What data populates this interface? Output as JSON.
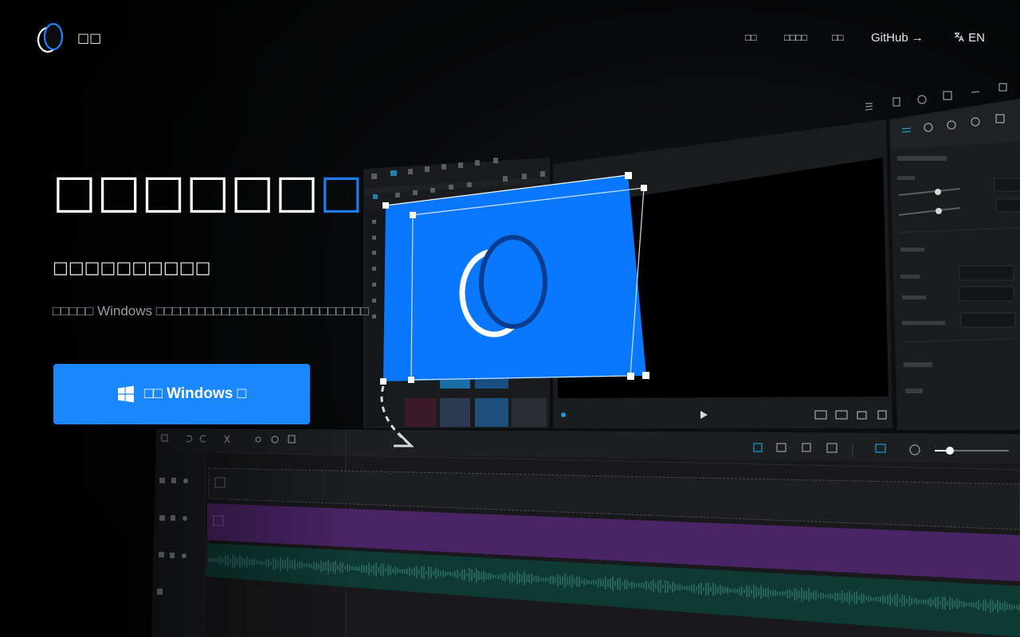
{
  "header": {
    "brand": "□□",
    "nav": [
      {
        "label": "□□"
      },
      {
        "label": "□□□□"
      },
      {
        "label": "□□"
      }
    ],
    "github_label": "GitHub →",
    "language_label": "EN"
  },
  "hero": {
    "title_main": "□□□□□□",
    "title_accent": "□",
    "subtitle": "□□□□□□□□□□",
    "description": "□□□□□ Windows □□□□□□□□□□□□□□□□□□□□□□□□□□",
    "download_label": "□□ Windows □"
  },
  "colors": {
    "accent": "#1a86ff",
    "title_accent": "#1b7cf0",
    "canvas_blue": "#0a77ff",
    "video_track": "#4a2466",
    "audio_track": "#0f3a34"
  },
  "icons": [
    "app-logo-icon",
    "translate-icon",
    "windows-icon",
    "egg-logo-icon"
  ]
}
